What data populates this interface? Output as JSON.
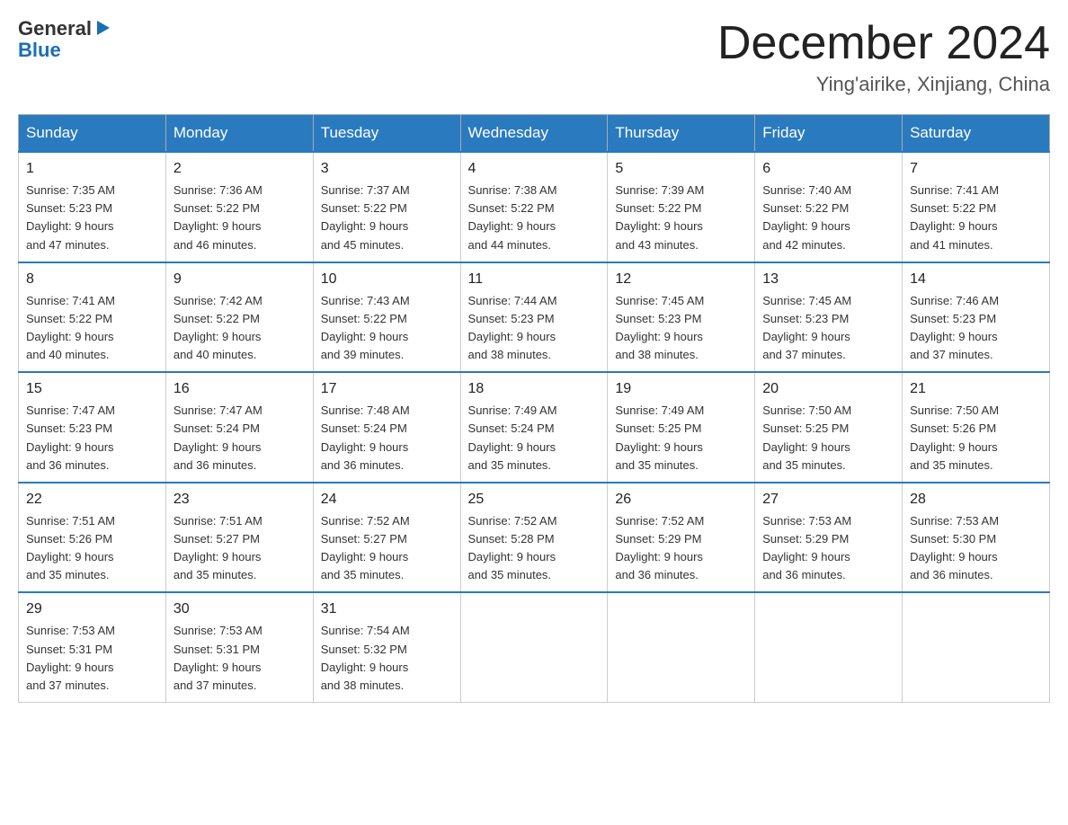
{
  "header": {
    "logo_text_general": "General",
    "logo_text_blue": "Blue",
    "month_title": "December 2024",
    "subtitle": "Ying'airike, Xinjiang, China"
  },
  "days_of_week": [
    "Sunday",
    "Monday",
    "Tuesday",
    "Wednesday",
    "Thursday",
    "Friday",
    "Saturday"
  ],
  "weeks": [
    [
      {
        "day": "1",
        "sunrise": "7:35 AM",
        "sunset": "5:23 PM",
        "daylight": "9 hours and 47 minutes."
      },
      {
        "day": "2",
        "sunrise": "7:36 AM",
        "sunset": "5:22 PM",
        "daylight": "9 hours and 46 minutes."
      },
      {
        "day": "3",
        "sunrise": "7:37 AM",
        "sunset": "5:22 PM",
        "daylight": "9 hours and 45 minutes."
      },
      {
        "day": "4",
        "sunrise": "7:38 AM",
        "sunset": "5:22 PM",
        "daylight": "9 hours and 44 minutes."
      },
      {
        "day": "5",
        "sunrise": "7:39 AM",
        "sunset": "5:22 PM",
        "daylight": "9 hours and 43 minutes."
      },
      {
        "day": "6",
        "sunrise": "7:40 AM",
        "sunset": "5:22 PM",
        "daylight": "9 hours and 42 minutes."
      },
      {
        "day": "7",
        "sunrise": "7:41 AM",
        "sunset": "5:22 PM",
        "daylight": "9 hours and 41 minutes."
      }
    ],
    [
      {
        "day": "8",
        "sunrise": "7:41 AM",
        "sunset": "5:22 PM",
        "daylight": "9 hours and 40 minutes."
      },
      {
        "day": "9",
        "sunrise": "7:42 AM",
        "sunset": "5:22 PM",
        "daylight": "9 hours and 40 minutes."
      },
      {
        "day": "10",
        "sunrise": "7:43 AM",
        "sunset": "5:22 PM",
        "daylight": "9 hours and 39 minutes."
      },
      {
        "day": "11",
        "sunrise": "7:44 AM",
        "sunset": "5:23 PM",
        "daylight": "9 hours and 38 minutes."
      },
      {
        "day": "12",
        "sunrise": "7:45 AM",
        "sunset": "5:23 PM",
        "daylight": "9 hours and 38 minutes."
      },
      {
        "day": "13",
        "sunrise": "7:45 AM",
        "sunset": "5:23 PM",
        "daylight": "9 hours and 37 minutes."
      },
      {
        "day": "14",
        "sunrise": "7:46 AM",
        "sunset": "5:23 PM",
        "daylight": "9 hours and 37 minutes."
      }
    ],
    [
      {
        "day": "15",
        "sunrise": "7:47 AM",
        "sunset": "5:23 PM",
        "daylight": "9 hours and 36 minutes."
      },
      {
        "day": "16",
        "sunrise": "7:47 AM",
        "sunset": "5:24 PM",
        "daylight": "9 hours and 36 minutes."
      },
      {
        "day": "17",
        "sunrise": "7:48 AM",
        "sunset": "5:24 PM",
        "daylight": "9 hours and 36 minutes."
      },
      {
        "day": "18",
        "sunrise": "7:49 AM",
        "sunset": "5:24 PM",
        "daylight": "9 hours and 35 minutes."
      },
      {
        "day": "19",
        "sunrise": "7:49 AM",
        "sunset": "5:25 PM",
        "daylight": "9 hours and 35 minutes."
      },
      {
        "day": "20",
        "sunrise": "7:50 AM",
        "sunset": "5:25 PM",
        "daylight": "9 hours and 35 minutes."
      },
      {
        "day": "21",
        "sunrise": "7:50 AM",
        "sunset": "5:26 PM",
        "daylight": "9 hours and 35 minutes."
      }
    ],
    [
      {
        "day": "22",
        "sunrise": "7:51 AM",
        "sunset": "5:26 PM",
        "daylight": "9 hours and 35 minutes."
      },
      {
        "day": "23",
        "sunrise": "7:51 AM",
        "sunset": "5:27 PM",
        "daylight": "9 hours and 35 minutes."
      },
      {
        "day": "24",
        "sunrise": "7:52 AM",
        "sunset": "5:27 PM",
        "daylight": "9 hours and 35 minutes."
      },
      {
        "day": "25",
        "sunrise": "7:52 AM",
        "sunset": "5:28 PM",
        "daylight": "9 hours and 35 minutes."
      },
      {
        "day": "26",
        "sunrise": "7:52 AM",
        "sunset": "5:29 PM",
        "daylight": "9 hours and 36 minutes."
      },
      {
        "day": "27",
        "sunrise": "7:53 AM",
        "sunset": "5:29 PM",
        "daylight": "9 hours and 36 minutes."
      },
      {
        "day": "28",
        "sunrise": "7:53 AM",
        "sunset": "5:30 PM",
        "daylight": "9 hours and 36 minutes."
      }
    ],
    [
      {
        "day": "29",
        "sunrise": "7:53 AM",
        "sunset": "5:31 PM",
        "daylight": "9 hours and 37 minutes."
      },
      {
        "day": "30",
        "sunrise": "7:53 AM",
        "sunset": "5:31 PM",
        "daylight": "9 hours and 37 minutes."
      },
      {
        "day": "31",
        "sunrise": "7:54 AM",
        "sunset": "5:32 PM",
        "daylight": "9 hours and 38 minutes."
      },
      null,
      null,
      null,
      null
    ]
  ],
  "labels": {
    "sunrise": "Sunrise:",
    "sunset": "Sunset:",
    "daylight": "Daylight:"
  }
}
